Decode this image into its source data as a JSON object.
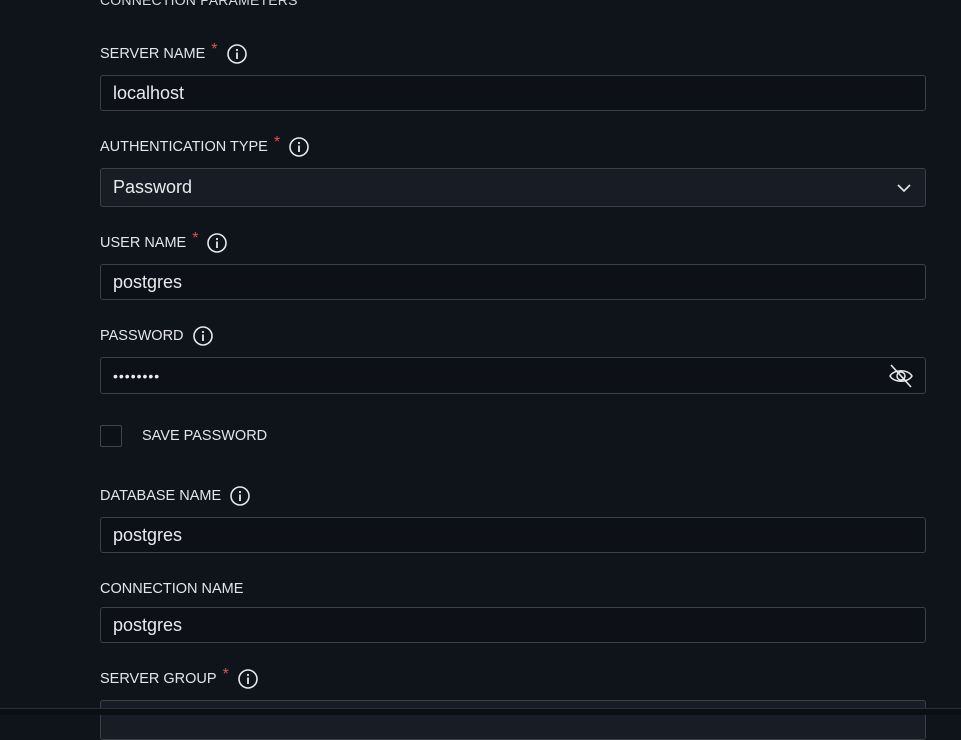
{
  "section": {
    "title": "CONNECTION PARAMETERS"
  },
  "fields": {
    "server_name": {
      "label": "SERVER NAME",
      "required_mark": "*",
      "value": "localhost"
    },
    "auth_type": {
      "label": "AUTHENTICATION TYPE",
      "required_mark": "*",
      "selected": "Password"
    },
    "user_name": {
      "label": "USER NAME",
      "required_mark": "*",
      "value": "postgres"
    },
    "password": {
      "label": "PASSWORD",
      "masked_value": "••••••••"
    },
    "save_password": {
      "label": "SAVE PASSWORD",
      "checked": false
    },
    "database_name": {
      "label": "DATABASE NAME",
      "value": "postgres"
    },
    "connection_name": {
      "label": "CONNECTION NAME",
      "value": "postgres"
    },
    "server_group": {
      "label": "SERVER GROUP",
      "required_mark": "*"
    }
  },
  "icons": {
    "info": "info-circle-icon",
    "dropdown": "chevron-down-icon",
    "visibility": "eye-off-icon"
  },
  "colors": {
    "background": "#0f131a",
    "input_background": "#0d1117",
    "select_background": "#181d25",
    "border": "#3a4048",
    "required": "#e05252",
    "text": "#e6e8ea"
  }
}
